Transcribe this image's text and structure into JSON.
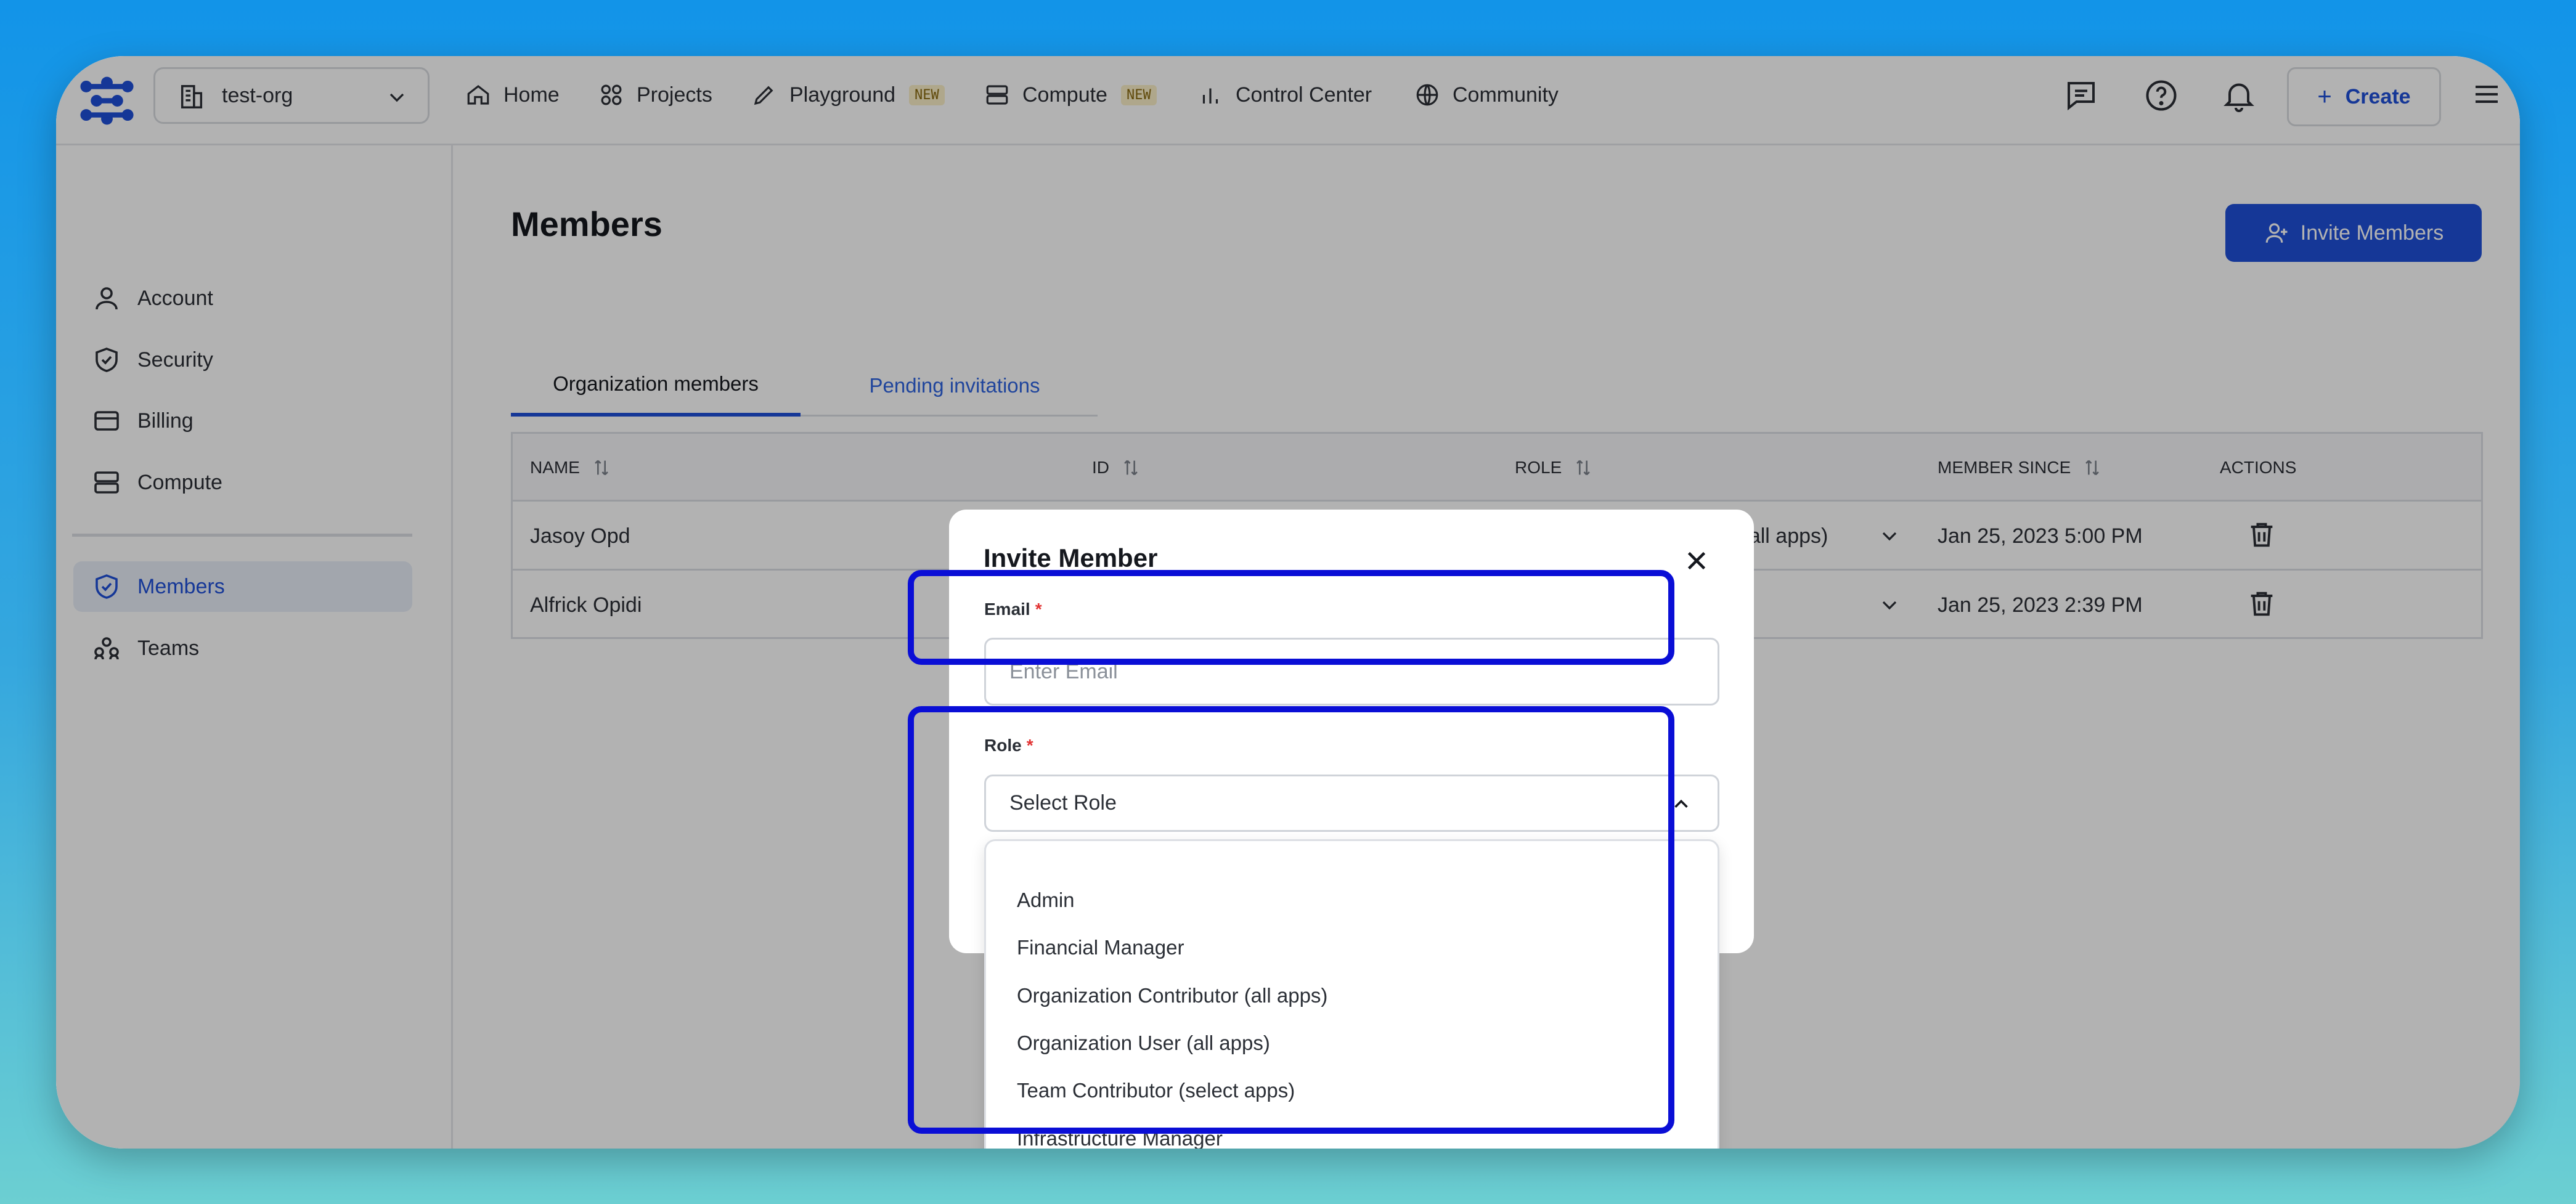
{
  "topnav": {
    "org": "test-org",
    "items": [
      {
        "label": "Home"
      },
      {
        "label": "Projects"
      },
      {
        "label": "Playground",
        "badge": "NEW"
      },
      {
        "label": "Compute",
        "badge": "NEW"
      },
      {
        "label": "Control Center"
      },
      {
        "label": "Community"
      }
    ],
    "create_label": "Create"
  },
  "sidebar": {
    "items": [
      {
        "label": "Account"
      },
      {
        "label": "Security"
      },
      {
        "label": "Billing"
      },
      {
        "label": "Compute"
      },
      {
        "label": "Members",
        "active": true
      },
      {
        "label": "Teams"
      }
    ]
  },
  "main": {
    "title": "Members",
    "invite_button": "Invite Members",
    "tabs": [
      "Organization members",
      "Pending invitations"
    ],
    "columns": [
      "NAME",
      "ID",
      "ROLE",
      "MEMBER SINCE",
      "ACTIONS"
    ],
    "rows": [
      {
        "name": "Jasoy Opd",
        "role": "ibutor (all apps)",
        "since": "Jan 25, 2023 5:00 PM"
      },
      {
        "name": "Alfrick Opidi",
        "role": "",
        "since": "Jan 25, 2023 2:39 PM"
      }
    ]
  },
  "modal": {
    "title": "Invite Member",
    "email_label": "Email",
    "email_placeholder": "Enter Email",
    "role_label": "Role",
    "role_placeholder": "Select Role",
    "required_mark": "*",
    "role_options": [
      "Admin",
      "Financial Manager",
      "Organization Contributor (all apps)",
      "Organization User (all apps)",
      "Team Contributor (select apps)",
      "Infrastructure Manager"
    ]
  },
  "colors": {
    "accent": "#1f4fd8",
    "highlight": "#0a0ed6",
    "required": "#e23434"
  }
}
